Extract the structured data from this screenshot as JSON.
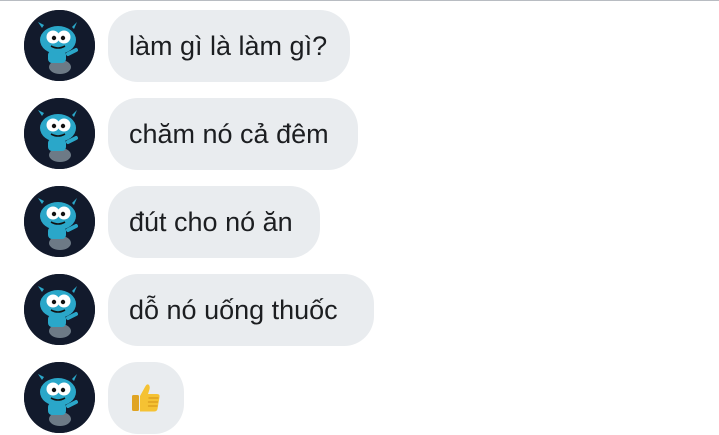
{
  "messages": [
    {
      "text": "làm gì là làm gì?"
    },
    {
      "text": "chăm nó cả đêm"
    },
    {
      "text": "đút cho nó ăn"
    },
    {
      "text": "dỗ nó uống thuốc"
    }
  ],
  "last_message": {
    "icon": "thumbs-up-icon"
  },
  "colors": {
    "bubble_bg": "#e9ecef",
    "text": "#1c1e21",
    "avatar_bg": "#121a2c",
    "character_blue": "#2aa7c9",
    "thumbs_yellow": "#f5c233"
  }
}
